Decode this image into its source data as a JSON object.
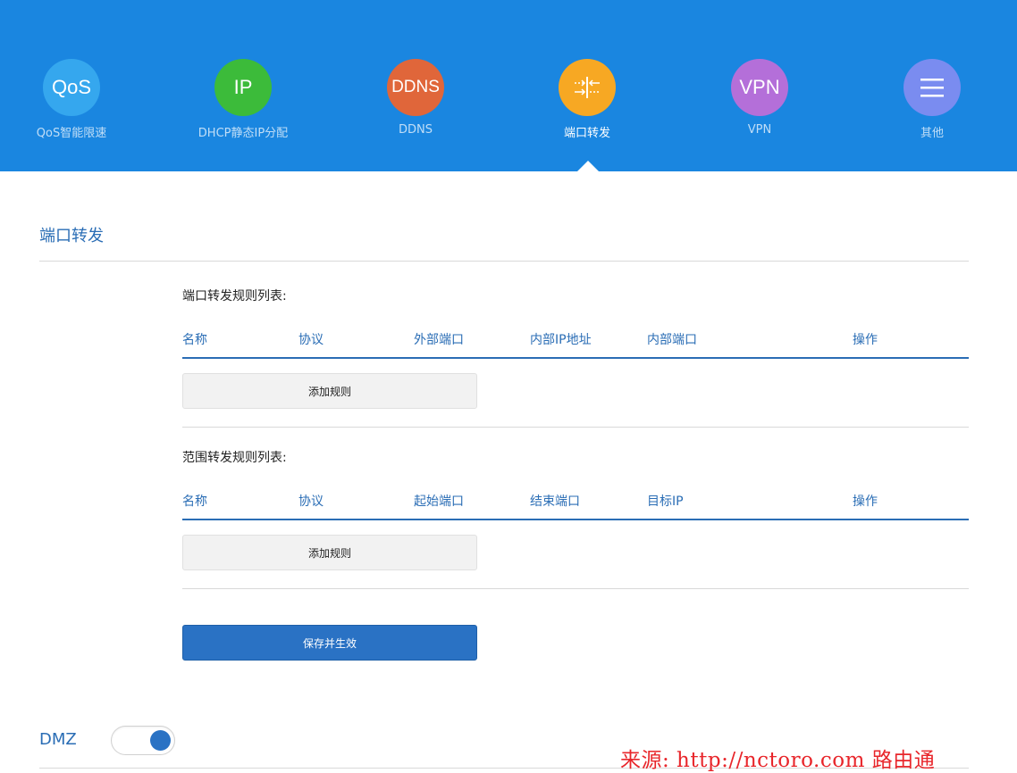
{
  "nav": {
    "items": [
      {
        "icon_text": "QoS",
        "label": "QoS智能限速",
        "color": "#35a7ee",
        "active": false
      },
      {
        "icon_text": "IP",
        "label": "DHCP静态IP分配",
        "color": "#3cbb3a",
        "active": false
      },
      {
        "icon_text": "DDNS",
        "label": "DDNS",
        "color": "#e0663a",
        "active": false
      },
      {
        "icon_text": "",
        "icon": "port-forward-icon",
        "label": "端口转发",
        "color": "#f7a823",
        "active": true
      },
      {
        "icon_text": "VPN",
        "label": "VPN",
        "color": "#b46fd9",
        "active": false
      },
      {
        "icon_text": "",
        "icon": "menu-icon",
        "label": "其他",
        "color": "#7a8cf0",
        "active": false
      }
    ]
  },
  "section_title": "端口转发",
  "port_rules": {
    "title": "端口转发规则列表:",
    "columns": [
      "名称",
      "协议",
      "外部端口",
      "内部IP地址",
      "内部端口",
      "操作"
    ],
    "add_label": "添加规则"
  },
  "range_rules": {
    "title": "范围转发规则列表:",
    "columns": [
      "名称",
      "协议",
      "起始端口",
      "结束端口",
      "目标IP",
      "操作"
    ],
    "add_label": "添加规则"
  },
  "save_label": "保存并生效",
  "dmz": {
    "label": "DMZ",
    "enabled": true
  },
  "watermark": "来源: http://nctoro.com 路由通",
  "colors": {
    "topbar": "#1a86e0",
    "accent": "#2a6db5",
    "primary_button": "#2a72c4",
    "watermark": "#e8262b"
  }
}
